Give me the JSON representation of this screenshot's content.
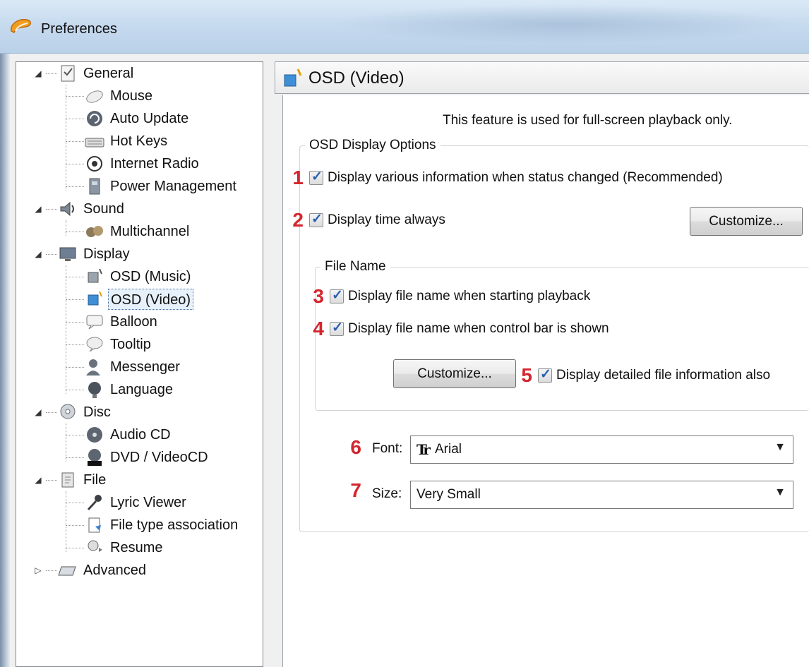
{
  "window": {
    "title": "Preferences"
  },
  "tree": {
    "items": [
      {
        "label": "General",
        "level": 0,
        "expanded": true,
        "icon": "general-icon"
      },
      {
        "label": "Mouse",
        "level": 1,
        "icon": "mouse-icon"
      },
      {
        "label": "Auto Update",
        "level": 1,
        "icon": "auto-update-icon"
      },
      {
        "label": "Hot Keys",
        "level": 1,
        "icon": "keyboard-icon"
      },
      {
        "label": "Internet Radio",
        "level": 1,
        "icon": "radio-icon"
      },
      {
        "label": "Power Management",
        "level": 1,
        "icon": "power-icon"
      },
      {
        "label": "Sound",
        "level": 0,
        "expanded": true,
        "icon": "sound-icon"
      },
      {
        "label": "Multichannel",
        "level": 1,
        "icon": "multichannel-icon"
      },
      {
        "label": "Display",
        "level": 0,
        "expanded": true,
        "icon": "display-icon"
      },
      {
        "label": "OSD (Music)",
        "level": 1,
        "icon": "osd-music-icon"
      },
      {
        "label": "OSD (Video)",
        "level": 1,
        "icon": "osd-video-icon",
        "selected": true
      },
      {
        "label": "Balloon",
        "level": 1,
        "icon": "balloon-icon"
      },
      {
        "label": "Tooltip",
        "level": 1,
        "icon": "tooltip-icon"
      },
      {
        "label": "Messenger",
        "level": 1,
        "icon": "messenger-icon"
      },
      {
        "label": "Language",
        "level": 1,
        "icon": "language-icon"
      },
      {
        "label": "Disc",
        "level": 0,
        "expanded": true,
        "icon": "disc-icon"
      },
      {
        "label": "Audio CD",
        "level": 1,
        "icon": "audio-cd-icon"
      },
      {
        "label": "DVD / VideoCD",
        "level": 1,
        "icon": "dvd-icon"
      },
      {
        "label": "File",
        "level": 0,
        "expanded": true,
        "icon": "file-icon"
      },
      {
        "label": "Lyric Viewer",
        "level": 1,
        "icon": "microphone-icon"
      },
      {
        "label": "File type association",
        "level": 1,
        "icon": "file-association-icon"
      },
      {
        "label": "Resume",
        "level": 1,
        "icon": "resume-icon"
      },
      {
        "label": "Advanced",
        "level": 0,
        "expanded": false,
        "icon": "advanced-icon"
      }
    ]
  },
  "panel": {
    "title": "OSD (Video)",
    "notice": "This feature is used for full-screen playback only.",
    "osd_group": {
      "legend": "OSD Display Options",
      "opt1": {
        "number": "1",
        "label": "Display various information when status changed (Recommended)",
        "checked": true
      },
      "opt2": {
        "number": "2",
        "label": "Display time always",
        "checked": true
      },
      "customize_label": "Customize...",
      "file_group": {
        "legend": "File Name",
        "opt3": {
          "number": "3",
          "label": "Display file name when starting playback",
          "checked": true
        },
        "opt4": {
          "number": "4",
          "label": "Display file name when control bar is shown",
          "checked": true
        },
        "customize_label": "Customize...",
        "opt5": {
          "number": "5",
          "label": "Display detailed file information also",
          "checked": true
        }
      },
      "font": {
        "number": "6",
        "label": "Font:",
        "value": "Arial",
        "glyph": "Tr"
      },
      "size": {
        "number": "7",
        "label": "Size:",
        "value": "Very Small"
      }
    }
  },
  "colors": {
    "annotation": "#d3262e",
    "check": "#2a5fb0"
  }
}
